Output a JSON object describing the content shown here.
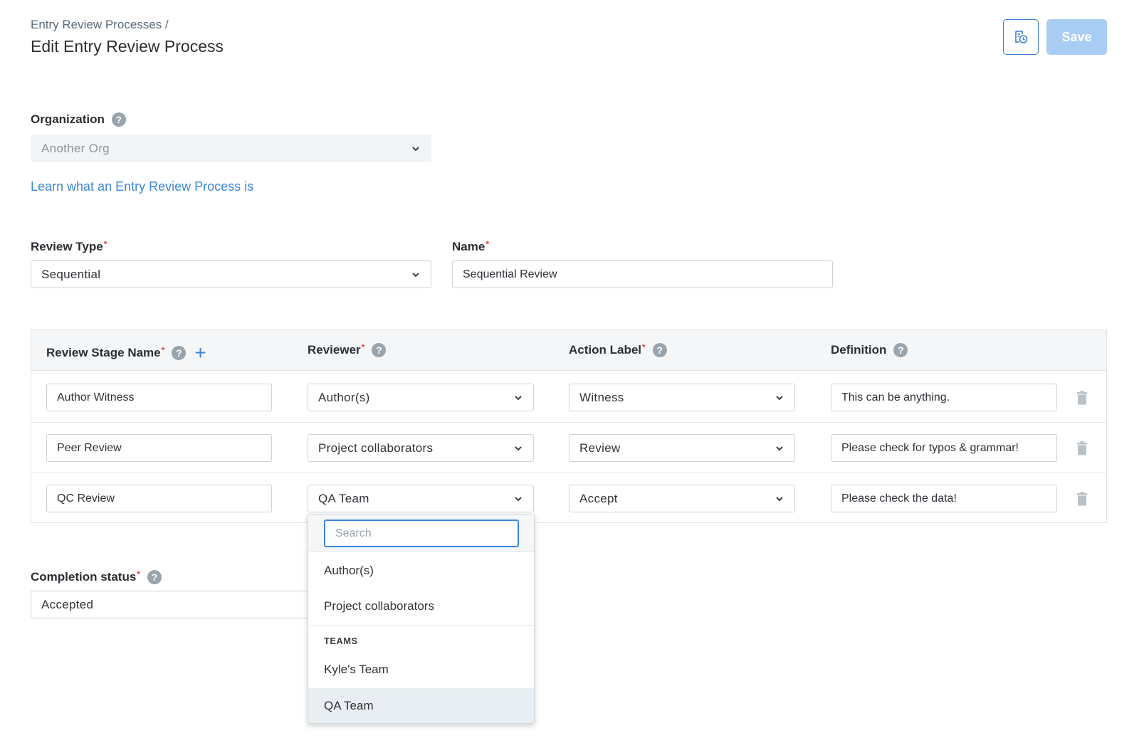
{
  "header": {
    "breadcrumb": "Entry Review Processes /",
    "title": "Edit Entry Review Process",
    "history_icon": "history-icon",
    "save_label": "Save"
  },
  "organization": {
    "label": "Organization",
    "value": "Another Org",
    "disabled": true
  },
  "learn_link": "Learn what an Entry Review Process is",
  "review_type": {
    "label": "Review Type",
    "required_mark": "*",
    "value": "Sequential"
  },
  "name_field": {
    "label": "Name",
    "required_mark": "*",
    "value": "Sequential Review"
  },
  "stages": {
    "columns": {
      "stage_name": "Review Stage Name",
      "reviewer": "Reviewer",
      "action_label": "Action Label",
      "definition": "Definition"
    },
    "required_mark": "*",
    "rows": [
      {
        "name": "Author Witness",
        "reviewer": "Author(s)",
        "action": "Witness",
        "definition": "This can be anything."
      },
      {
        "name": "Peer Review",
        "reviewer": "Project collaborators",
        "action": "Review",
        "definition": "Please check for typos & grammar!"
      },
      {
        "name": "QC Review",
        "reviewer": "QA Team",
        "action": "Accept",
        "definition": "Please check the data!"
      }
    ]
  },
  "completion_status": {
    "label": "Completion status",
    "required_mark": "*",
    "value": "Accepted"
  },
  "reviewer_dropdown": {
    "search_placeholder": "Search",
    "options": [
      "Author(s)",
      "Project collaborators"
    ],
    "group_label": "TEAMS",
    "team_options": [
      "Kyle's Team",
      "QA Team"
    ],
    "selected": "QA Team"
  },
  "colors": {
    "accent": "#3c87d8",
    "save_disabled": "#a9cdf5",
    "required": "#e0403f"
  }
}
